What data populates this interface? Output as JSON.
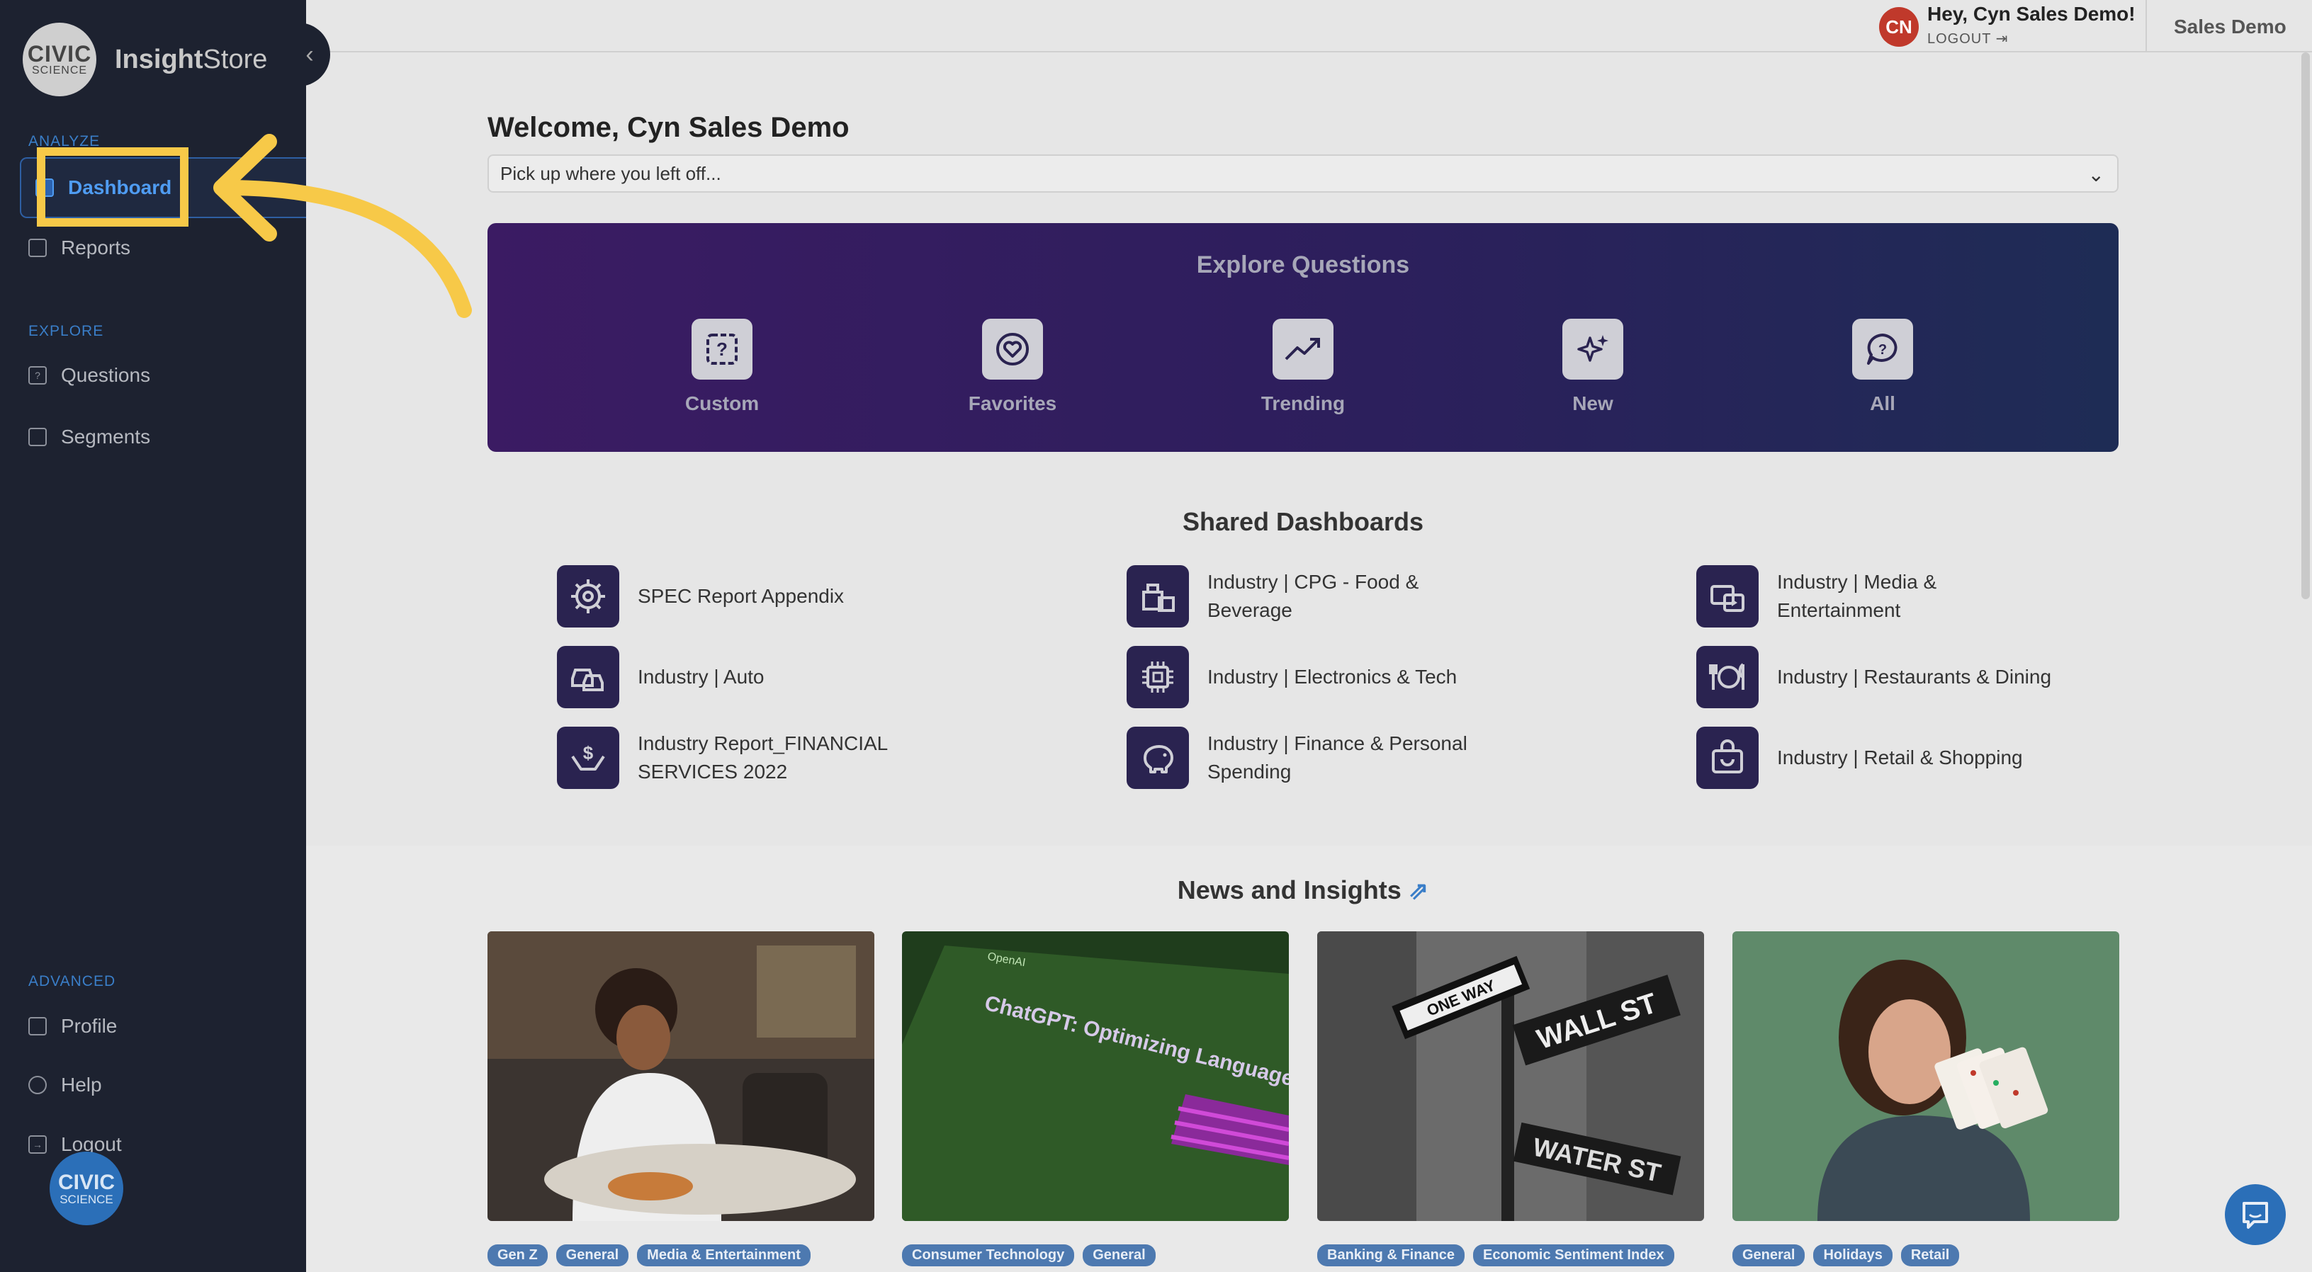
{
  "app": {
    "logo_line1": "CIVIC",
    "logo_line2": "SCIENCE",
    "name_bold": "Insight",
    "name_rest": "Store",
    "collapse_glyph": "‹"
  },
  "sidebar": {
    "sections": [
      {
        "label": "ANALYZE",
        "items": [
          {
            "label": "Dashboard",
            "icon": "dashboard-icon"
          },
          {
            "label": "Reports",
            "icon": "reports-icon"
          }
        ]
      },
      {
        "label": "EXPLORE",
        "items": [
          {
            "label": "Questions",
            "icon": "questions-icon"
          },
          {
            "label": "Segments",
            "icon": "segments-icon"
          }
        ]
      },
      {
        "label": "ADVANCED",
        "items": [
          {
            "label": "Profile",
            "icon": "profile-icon"
          },
          {
            "label": "Help",
            "icon": "help-icon"
          },
          {
            "label": "Logout",
            "icon": "logout-icon"
          }
        ]
      }
    ],
    "badge_line1": "CIVIC",
    "badge_line2": "SCIENCE"
  },
  "topbar": {
    "avatar_initials": "CN",
    "greeting": "Hey, Cyn Sales Demo!",
    "logout_label": "LOGOUT",
    "account_name": "Sales Demo"
  },
  "main": {
    "welcome": "Welcome, Cyn Sales Demo",
    "resume_select_value": "Pick up where you left off...",
    "explore": {
      "title": "Explore Questions",
      "items": [
        {
          "label": "Custom",
          "icon": "custom-question-icon"
        },
        {
          "label": "Favorites",
          "icon": "favorites-heart-icon"
        },
        {
          "label": "Trending",
          "icon": "trending-chart-icon"
        },
        {
          "label": "New",
          "icon": "new-sparkle-icon"
        },
        {
          "label": "All",
          "icon": "all-chat-icon"
        }
      ]
    },
    "shared": {
      "title": "Shared Dashboards",
      "items": [
        {
          "label": "SPEC Report Appendix",
          "icon": "gear-target-icon"
        },
        {
          "label": "Industry | CPG - Food & Beverage",
          "icon": "grocery-icon"
        },
        {
          "label": "Industry | Media & Entertainment",
          "icon": "media-icon"
        },
        {
          "label": "Industry | Auto",
          "icon": "cars-icon"
        },
        {
          "label": "Industry | Electronics & Tech",
          "icon": "chip-icon"
        },
        {
          "label": "Industry | Restaurants & Dining",
          "icon": "plate-utensils-icon"
        },
        {
          "label": "Industry Report_FINANCIAL SERVICES 2022",
          "icon": "hand-dollar-icon"
        },
        {
          "label": "Industry | Finance & Personal Spending",
          "icon": "piggy-bank-icon"
        },
        {
          "label": "Industry | Retail & Shopping",
          "icon": "shopping-bag-icon"
        }
      ]
    },
    "news": {
      "title": "News and Insights",
      "cards": [
        {
          "image": "people-dining-photo",
          "tags": [
            "Gen Z",
            "General",
            "Media & Entertainment"
          ]
        },
        {
          "image": "chatgpt-screen-photo",
          "overlay_text": "ChatGPT: Optimizing Language Models for Dialogue",
          "overlay_brand": "OpenAI",
          "tags": [
            "Consumer Technology",
            "General"
          ]
        },
        {
          "image": "wall-street-sign-photo",
          "sign1": "ONE WAY",
          "sign2": "WALL ST",
          "sign3": "WATER ST",
          "tags": [
            "Banking & Finance",
            "Economic Sentiment Index"
          ]
        },
        {
          "image": "woman-gift-cards-photo",
          "tags": [
            "General",
            "Holidays",
            "Retail"
          ]
        }
      ]
    }
  },
  "colors": {
    "sidebar_bg": "#1d2230",
    "accent_blue": "#3a7ec8",
    "highlight_yellow": "#f7c948",
    "explore_start": "#3b1b63",
    "explore_end": "#1e2c55"
  }
}
